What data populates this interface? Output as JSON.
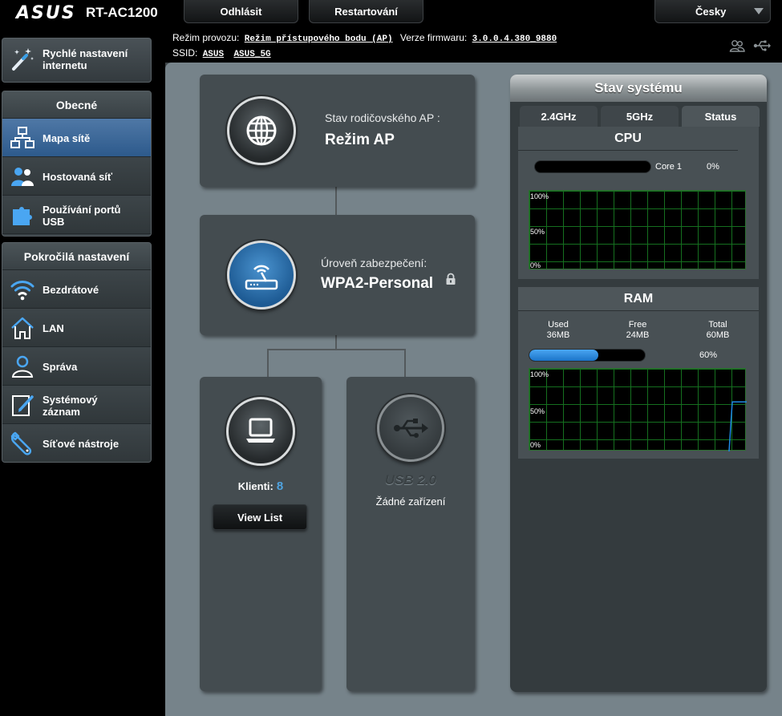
{
  "brand": {
    "logo": "ASUS",
    "model": "RT-AC1200"
  },
  "topbar": {
    "logout_label": "Odhlásit",
    "restart_label": "Restartování",
    "language": "Česky"
  },
  "info": {
    "mode_label": "Režim provozu:",
    "mode_value": "Režim přístupového bodu (AP)",
    "firmware_label": "Verze firmwaru:",
    "firmware_value": "3.0.0.4.380_9880",
    "ssid_label": "SSID:",
    "ssid_1": "ASUS",
    "ssid_2": "ASUS_5G"
  },
  "sidebar": {
    "quick_setup_line1": "Rychlé nastavení",
    "quick_setup_line2": "internetu",
    "general_header": "Obecné",
    "general_items": [
      {
        "label": "Mapa sítě",
        "icon": "network-map-icon",
        "active": true
      },
      {
        "label": "Hostovaná síť",
        "icon": "guest-network-icon"
      },
      {
        "label_line1": "Používání portů",
        "label_line2": "USB",
        "icon": "usb-app-icon"
      }
    ],
    "advanced_header": "Pokročilá nastavení",
    "advanced_items": [
      {
        "label": "Bezdrátové",
        "icon": "wireless-icon"
      },
      {
        "label": "LAN",
        "icon": "lan-house-icon"
      },
      {
        "label": "Správa",
        "icon": "admin-user-icon"
      },
      {
        "label_line1": "Systémový",
        "label_line2": "záznam",
        "icon": "system-log-icon"
      },
      {
        "label": "Síťové nástroje",
        "icon": "network-tools-icon"
      }
    ]
  },
  "network_map": {
    "ap_status_label": "Stav rodičovského AP :",
    "ap_status_value": "Režim AP",
    "security_label": "Úroveň zabezpečení:",
    "security_value": "WPA2-Personal",
    "clients_label": "Klienti:",
    "clients_count": "8",
    "view_list_label": "View List",
    "usb_title": "USB 2.0",
    "usb_status": "Žádné zařízení"
  },
  "system_status": {
    "title": "Stav systému",
    "tabs": [
      "2.4GHz",
      "5GHz",
      "Status"
    ],
    "active_tab": "Status",
    "cpu": {
      "title": "CPU",
      "core_label": "Core 1",
      "core_percent": "0%",
      "core_value": 0,
      "graph_labels": [
        "100%",
        "50%",
        "0%"
      ]
    },
    "ram": {
      "title": "RAM",
      "used_label": "Used",
      "used_value": "36MB",
      "free_label": "Free",
      "free_value": "24MB",
      "total_label": "Total",
      "total_value": "60MB",
      "usage_percent": "60%",
      "usage_value": 60,
      "graph_labels": [
        "100%",
        "50%",
        "0%"
      ]
    }
  },
  "colors": {
    "accent_blue": "#4fa3e0",
    "active_menu": "#2d5a8c",
    "graph_grid": "#156f1f",
    "graph_line": "#1e88e5"
  }
}
